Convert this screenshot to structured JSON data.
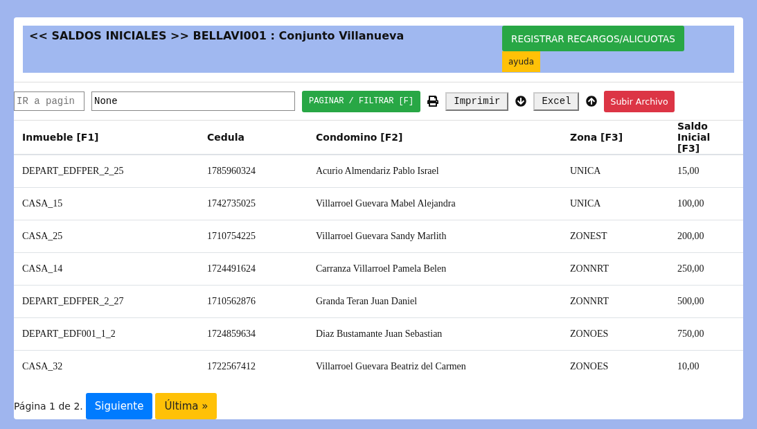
{
  "header": {
    "title": "<< SALDOS INICIALES >> BELLAVI001 : Conjunto Villanueva",
    "register_button": "REGISTRAR RECARGOS/ALICUOTAS",
    "help_button": "ayuda"
  },
  "toolbar": {
    "page_field": {
      "placeholder": "IR a pagin"
    },
    "filter_field": {
      "value": "None"
    },
    "filter_button": "PAGINAR / FILTRAR [F]",
    "print_button": "Imprimir",
    "excel_button": "Excel",
    "upload_button": "Subir Archivo"
  },
  "table": {
    "columns": [
      "Inmueble [F1]",
      "Cedula",
      "Condomino [F2]",
      "Zona [F3]",
      "Saldo Inicial [F3]"
    ],
    "rows": [
      [
        "DEPART_EDFPER_2_25",
        "1785960324",
        "Acurio Almendariz Pablo Israel",
        "UNICA",
        "15,00"
      ],
      [
        "CASA_15",
        "1742735025",
        "Villarroel Guevara Mabel Alejandra",
        "UNICA",
        "100,00"
      ],
      [
        "CASA_25",
        "1710754225",
        "Villarroel Guevara Sandy Marlith",
        "ZONEST",
        "200,00"
      ],
      [
        "CASA_14",
        "1724491624",
        "Carranza Villarroel Pamela Belen",
        "ZONNRT",
        "250,00"
      ],
      [
        "DEPART_EDFPER_2_27",
        "1710562876",
        "Granda Teran Juan Daniel",
        "ZONNRT",
        "500,00"
      ],
      [
        "DEPART_EDF001_1_2",
        "1724859634",
        "Diaz Bustamante Juan Sebastian",
        "ZONOES",
        "750,00"
      ],
      [
        "CASA_32",
        "1722567412",
        "Villarroel Guevara Beatriz del Carmen",
        "ZONOES",
        "10,00"
      ]
    ]
  },
  "pagination": {
    "info": "Página 1 de 2.",
    "next_button": "Siguiente",
    "last_button": "Última »"
  }
}
